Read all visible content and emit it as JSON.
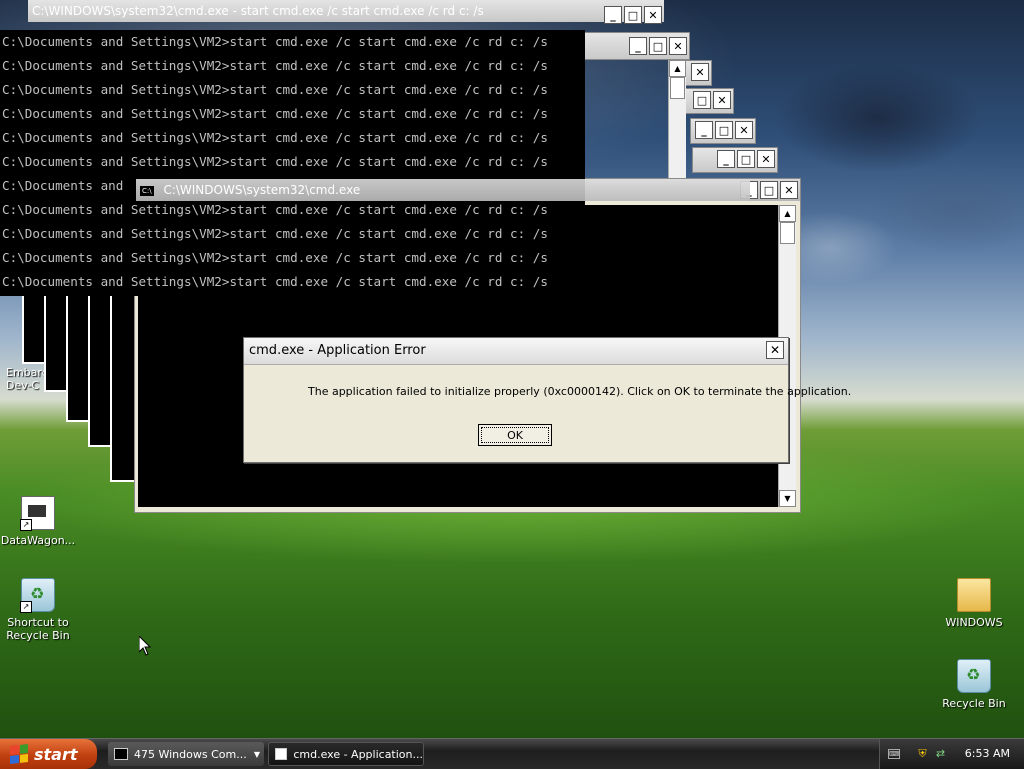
{
  "windows": {
    "back_title": "C:\\WINDOWS\\system32\\cmd.exe - start cmd.exe /c start cmd.exe /c rd c: /s",
    "front_title": "C:\\WINDOWS\\system32\\cmd.exe",
    "cmd_icon": "C:\\"
  },
  "console": {
    "lines": [
      "C:\\Documents and Settings\\VM2>start cmd.exe /c start cmd.exe /c rd c: /s",
      "C:\\Documents and Settings\\VM2>start cmd.exe /c start cmd.exe /c rd c: /s",
      "C:\\Documents and Settings\\VM2>start cmd.exe /c start cmd.exe /c rd c: /s",
      "C:\\Documents and Settings\\VM2>start cmd.exe /c start cmd.exe /c rd c: /s",
      "C:\\Documents and Settings\\VM2>start cmd.exe /c start cmd.exe /c rd c: /s",
      "C:\\Documents and Settings\\VM2>start cmd.exe /c start cmd.exe /c rd c: /s",
      "C:\\Documents and",
      "C:\\Documents and Settings\\VM2>start cmd.exe /c start cmd.exe /c rd c: /s",
      "C:\\Documents and Settings\\VM2>start cmd.exe /c start cmd.exe /c rd c: /s",
      "C:\\Documents and Settings\\VM2>start cmd.exe /c start cmd.exe /c rd c: /s",
      "C:\\Documents and Settings\\VM2>start cmd.exe /c start cmd.exe /c rd c: /s"
    ]
  },
  "dialog": {
    "title": "cmd.exe - Application Error",
    "message": "The application failed to initialize properly (0xc0000142). Click on OK to terminate the application.",
    "ok_label": "OK"
  },
  "desktop_icons": {
    "embarc_label": "Embarc\nDev-C",
    "datawagon_label": "DataWagon...",
    "shortcut_recycle_label": "Shortcut to\nRecycle Bin",
    "windows_label": "WINDOWS",
    "recycle_label": "Recycle Bin"
  },
  "taskbar": {
    "start_label": "start",
    "task1_label": "475 Windows Com...",
    "task2_label": "cmd.exe - Application...",
    "clock": "6:53 AM"
  },
  "colors": {
    "console_bg": "#000000",
    "console_fg": "#c0c0c0",
    "start_green": "#3c9a2a"
  }
}
